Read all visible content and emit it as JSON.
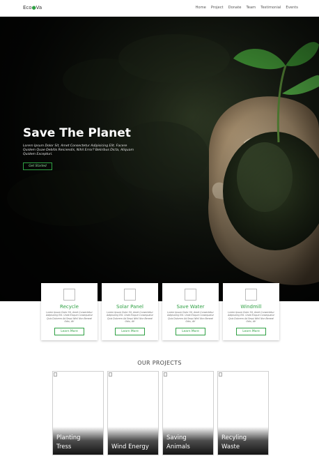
{
  "nav": {
    "logo": {
      "prefix": "Eco",
      "mark": "●",
      "suffix": "Va"
    },
    "links": [
      "Home",
      "Project",
      "Donate",
      "Team",
      "Testimonial",
      "Events"
    ]
  },
  "hero": {
    "title": "Save The Planet",
    "text": "Lorem Ipsum Dolor Sit, Amet Consectetur Adipisicing Elit. Facere Quidem Quae Debitis Reiciendis, Nihil Error? Beliribus Dicta, Aliquam Quidem Excepturi.",
    "button": "Get Started"
  },
  "cards": [
    {
      "title": "Recycle",
      "desc": "Lorem Ipsum Dolor Sit, Amet Consectetur Adipisicing Elit. Unde Eloque Consequatur Quis Dolorem Ad Sequi Nihil Non Beneat Odio, At!",
      "button": "Learn More"
    },
    {
      "title": "Solar Panel",
      "desc": "Lorem Ipsum Dolor Sit, Amet Consectetur Adipisicing Elit. Unde Eloque Consequatur Quis Dolorem Ad Sequi Nihil Non Beneat Odio, At!",
      "button": "Learn More"
    },
    {
      "title": "Save Water",
      "desc": "Lorem Ipsum Dolor Sit, Amet Consectetur Adipisicing Elit. Unde Eloque Consequatur Quis Dolorem Ad Sequi Nihil Non Beneat Odio, At!",
      "button": "Learn More"
    },
    {
      "title": "Windmill",
      "desc": "Lorem Ipsum Dolor Sit, Amet Consectetur Adipisicing Elit. Unde Eloque Consequatur Quis Dolorem Ad Sequi Nihil Non Beneat Odio, At!",
      "button": "Learn More"
    }
  ],
  "projects": {
    "heading": "OUR PROJECTS",
    "items": [
      {
        "line1": "Planting",
        "line2": "Tress"
      },
      {
        "line1": "",
        "line2": "Wind Energy"
      },
      {
        "line1": "Saving",
        "line2": "Animals"
      },
      {
        "line1": "Recyling",
        "line2": "Waste"
      }
    ]
  },
  "colors": {
    "accent": "#2ea043",
    "hero_dark": "#0b0d0a",
    "leaf": "#3fa845"
  },
  "icons": [
    "broken-image-icon"
  ]
}
